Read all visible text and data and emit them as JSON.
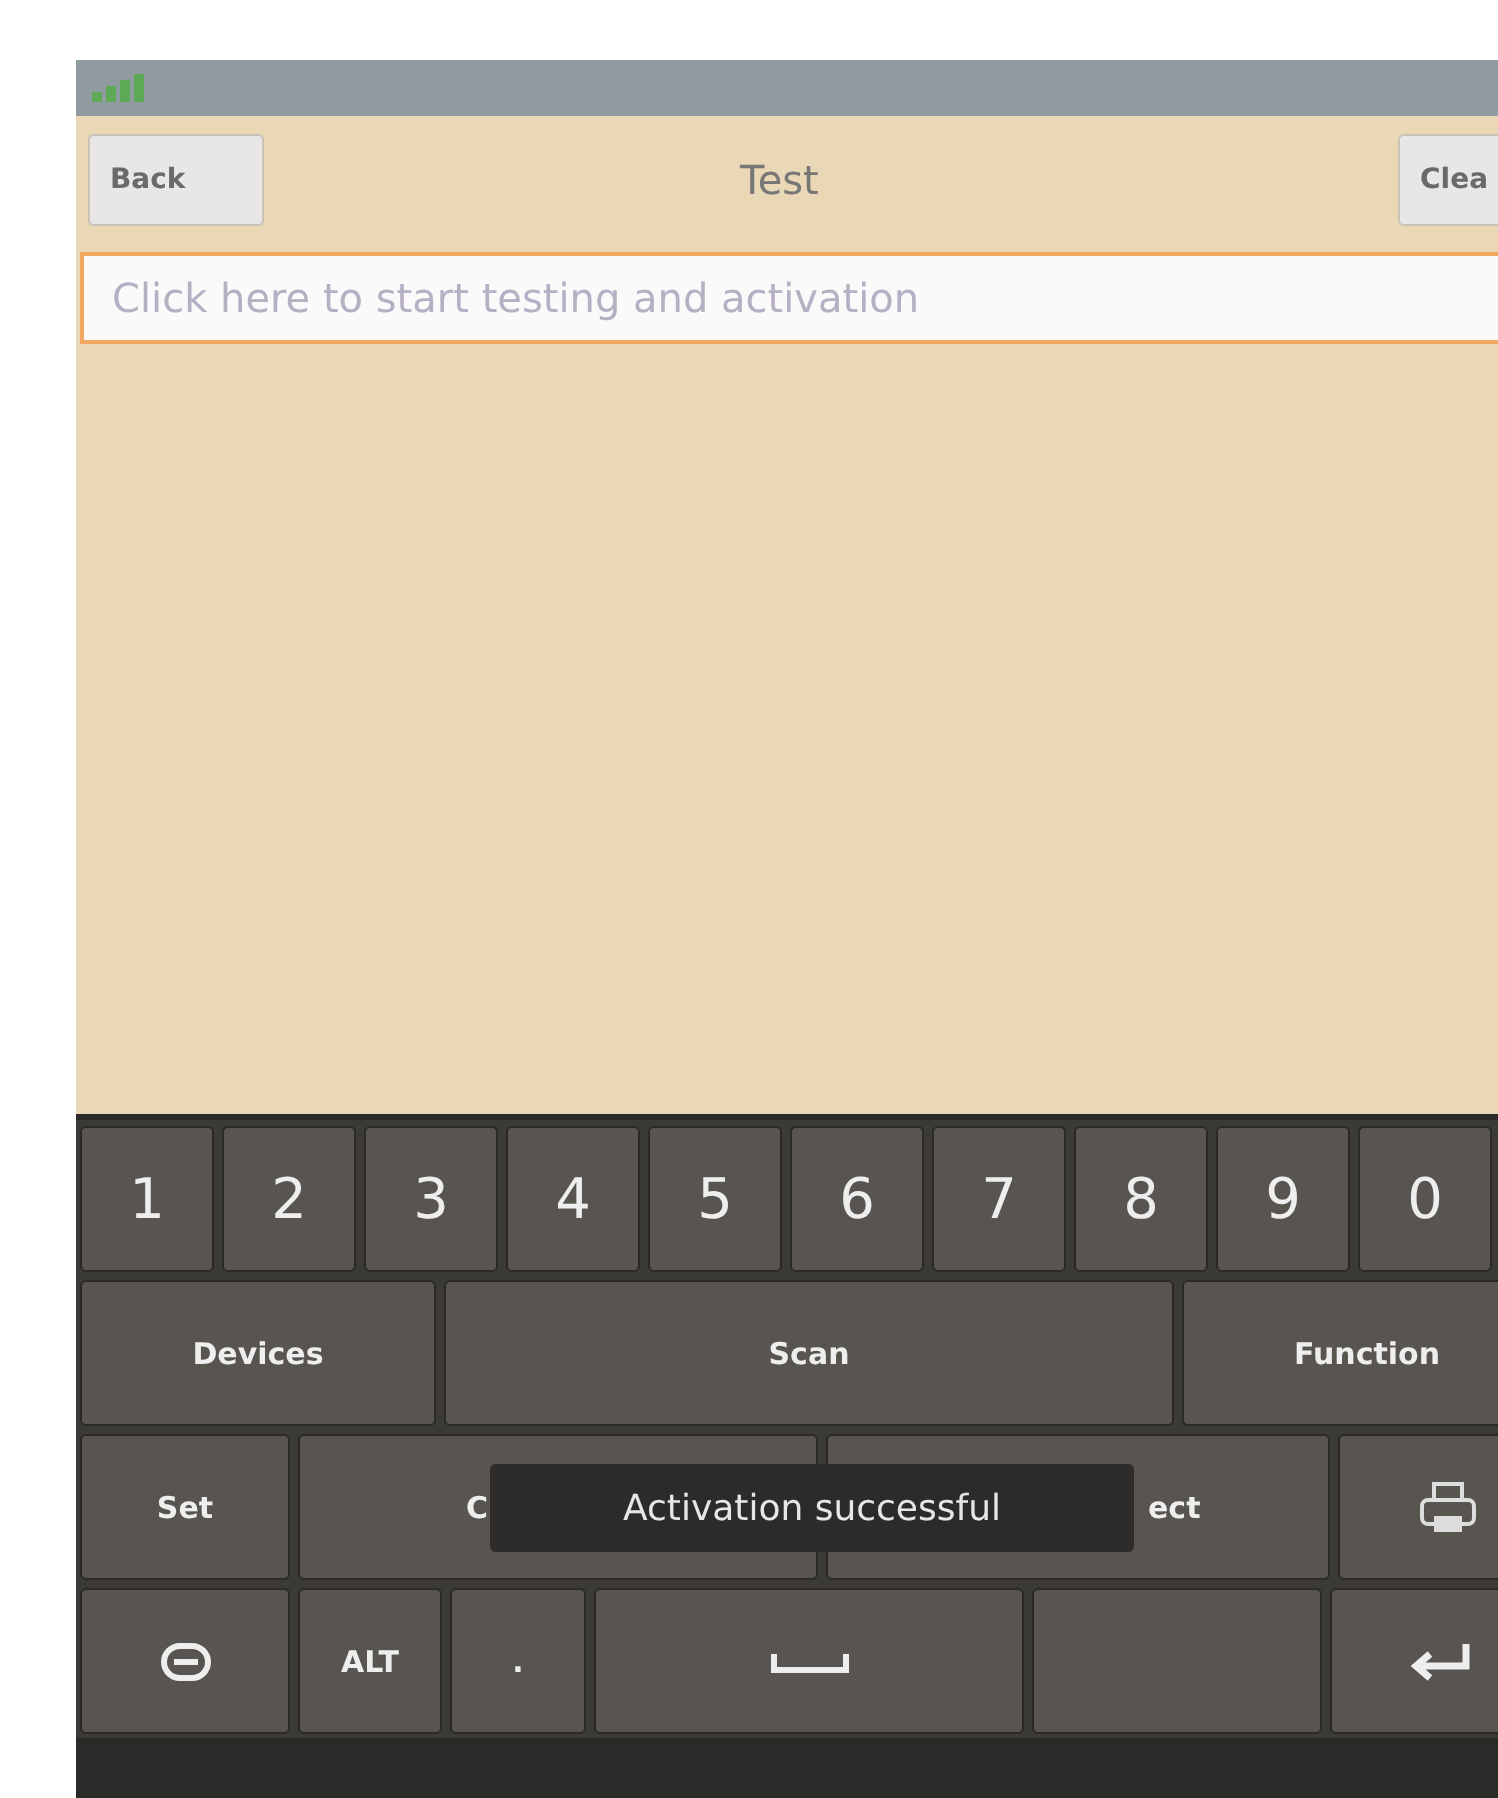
{
  "header": {
    "back_button": "Back",
    "title": "Test",
    "clear_button": "Clea"
  },
  "field": {
    "placeholder": "Click here to start testing and activation"
  },
  "keyboard": {
    "number_row": [
      {
        "kind": "text",
        "label": "1"
      },
      {
        "kind": "text",
        "label": "2"
      },
      {
        "kind": "text",
        "label": "3"
      },
      {
        "kind": "text",
        "label": "4"
      },
      {
        "kind": "text",
        "label": "5"
      },
      {
        "kind": "text",
        "label": "6"
      },
      {
        "kind": "text",
        "label": "7"
      },
      {
        "kind": "text",
        "label": "8"
      },
      {
        "kind": "text",
        "label": "9"
      },
      {
        "kind": "text",
        "label": "0"
      }
    ],
    "command_row": [
      {
        "kind": "text",
        "label": "Devices"
      },
      {
        "kind": "text",
        "label": "Scan"
      },
      {
        "kind": "text",
        "label": "Function"
      }
    ],
    "option_row": [
      {
        "kind": "text",
        "label": "Set"
      },
      {
        "kind": "endtext",
        "label": "C"
      },
      {
        "kind": "starttext",
        "label": "ect"
      },
      {
        "kind": "device"
      }
    ],
    "bottom_row": [
      {
        "kind": "toggle"
      },
      {
        "kind": "text",
        "label": "ALT"
      },
      {
        "kind": "text",
        "label": "."
      },
      {
        "kind": "space"
      },
      {
        "kind": "blank"
      },
      {
        "kind": "enter"
      }
    ]
  },
  "toast": "Activation successful"
}
